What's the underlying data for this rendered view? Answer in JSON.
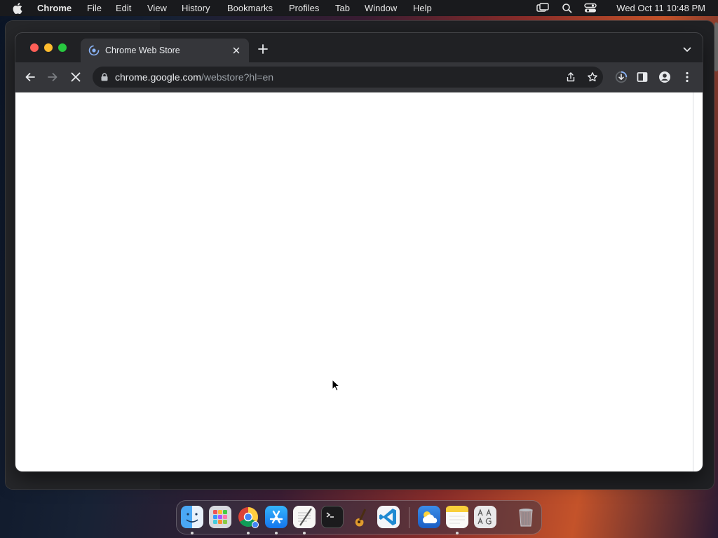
{
  "menubar": {
    "app_name": "Chrome",
    "items": [
      "File",
      "Edit",
      "View",
      "History",
      "Bookmarks",
      "Profiles",
      "Tab",
      "Window",
      "Help"
    ],
    "status_icons": [
      "screen-mirroring-icon",
      "spotlight-search-icon",
      "control-center-icon"
    ],
    "clock": "Wed Oct 11  10:48 PM"
  },
  "browser": {
    "tab": {
      "title": "Chrome Web Store",
      "favicon": "chrome-web-store-icon"
    },
    "address_bar": {
      "host": "chrome.google.com",
      "path": "/webstore?hl=en"
    },
    "loading": true,
    "toolbar_icons": [
      "back-icon",
      "forward-icon",
      "stop-loading-icon",
      "share-icon",
      "bookmark-star-icon",
      "downloads-icon",
      "side-panel-icon",
      "profile-icon",
      "menu-kebab-icon"
    ]
  },
  "dock": {
    "apps": [
      {
        "name": "Finder",
        "icon": "finder-icon",
        "running": true
      },
      {
        "name": "Launchpad",
        "icon": "launchpad-icon",
        "running": false
      },
      {
        "name": "Google Chrome",
        "icon": "chrome-icon",
        "running": true
      },
      {
        "name": "App Store",
        "icon": "app-store-icon",
        "running": true
      },
      {
        "name": "TextEdit",
        "icon": "textedit-icon",
        "running": true
      },
      {
        "name": "Terminal",
        "icon": "terminal-icon",
        "running": false
      },
      {
        "name": "GarageBand",
        "icon": "garageband-icon",
        "running": false
      },
      {
        "name": "Visual Studio Code",
        "icon": "vscode-icon",
        "running": false
      },
      {
        "name": "Weather",
        "icon": "weather-icon",
        "running": false
      },
      {
        "name": "Notes",
        "icon": "notes-icon",
        "running": true
      },
      {
        "name": "Font Book",
        "icon": "font-book-icon",
        "running": false
      },
      {
        "name": "Trash",
        "icon": "trash-icon",
        "running": false
      }
    ]
  },
  "colors": {
    "menubar_bg": "#191a1d",
    "chrome_frame": "#202124",
    "chrome_toolbar": "#35363a",
    "page_bg": "#ffffff",
    "link_blue": "#8ab4f8"
  }
}
